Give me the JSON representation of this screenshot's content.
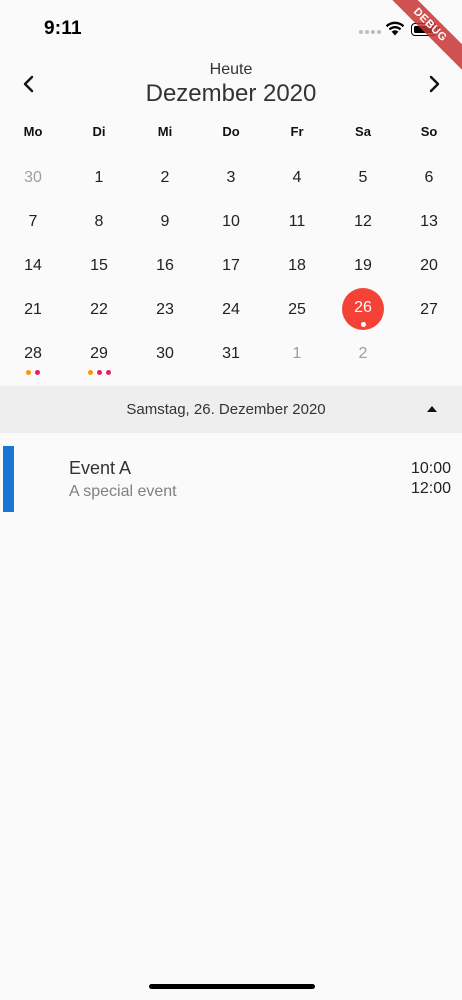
{
  "status_bar": {
    "time": "9:11"
  },
  "debug_banner": "DEBUG",
  "header": {
    "today_label": "Heute",
    "month_title": "Dezember 2020",
    "prev_icon": "chevron-left-icon",
    "next_icon": "chevron-right-icon"
  },
  "weekdays": [
    "Mo",
    "Di",
    "Mi",
    "Do",
    "Fr",
    "Sa",
    "So"
  ],
  "days": [
    {
      "label": "30",
      "outside": true
    },
    {
      "label": "1"
    },
    {
      "label": "2"
    },
    {
      "label": "3"
    },
    {
      "label": "4"
    },
    {
      "label": "5"
    },
    {
      "label": "6"
    },
    {
      "label": "7"
    },
    {
      "label": "8"
    },
    {
      "label": "9"
    },
    {
      "label": "10"
    },
    {
      "label": "11"
    },
    {
      "label": "12"
    },
    {
      "label": "13"
    },
    {
      "label": "14"
    },
    {
      "label": "15"
    },
    {
      "label": "16"
    },
    {
      "label": "17"
    },
    {
      "label": "18"
    },
    {
      "label": "19"
    },
    {
      "label": "20"
    },
    {
      "label": "21"
    },
    {
      "label": "22"
    },
    {
      "label": "23"
    },
    {
      "label": "24"
    },
    {
      "label": "25"
    },
    {
      "label": "26",
      "selected": true,
      "dots": [
        "#ffffff"
      ]
    },
    {
      "label": "27"
    },
    {
      "label": "28",
      "dots": [
        "#ff9800",
        "#e91e63"
      ]
    },
    {
      "label": "29",
      "dots": [
        "#ff9800",
        "#e91e63",
        "#e91e63"
      ]
    },
    {
      "label": "30"
    },
    {
      "label": "31"
    },
    {
      "label": "1",
      "outside": true
    },
    {
      "label": "2",
      "outside": true
    }
  ],
  "colors": {
    "selected": "#f44336",
    "event_accent": "#1976d2",
    "outside_day": "#9e9e9e"
  },
  "selected_date_bar": {
    "label": "Samstag, 26. Dezember 2020",
    "collapse_icon": "caret-up-icon"
  },
  "events": [
    {
      "title": "Event A",
      "subtitle": "A special event",
      "start": "10:00",
      "end": "12:00"
    }
  ]
}
